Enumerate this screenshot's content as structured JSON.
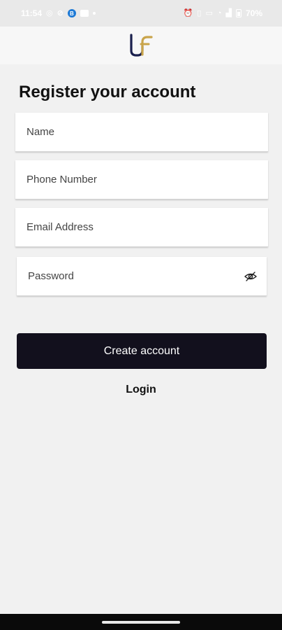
{
  "status_bar": {
    "time": "11:54",
    "battery": "70%",
    "left_icons": [
      "notification-icon",
      "no-sim-icon",
      "app-badge-icon",
      "message-icon",
      "dot-icon"
    ],
    "right_icons": [
      "alarm-icon",
      "vibrate-icon",
      "volte-icon",
      "wifi-icon",
      "signal-icon",
      "battery-icon"
    ]
  },
  "header": {
    "logo": "brand-logo-icon",
    "logo_colors": {
      "primary": "#1a1f4d",
      "accent": "#c9a44a"
    }
  },
  "form": {
    "title": "Register your account",
    "fields": {
      "name_placeholder": "Name",
      "phone_placeholder": "Phone Number",
      "email_placeholder": "Email Address",
      "password_placeholder": "Password"
    },
    "password_toggle_icon": "eye-off-icon"
  },
  "actions": {
    "create_label": "Create account",
    "login_label": "Login"
  },
  "colors": {
    "background": "#f1f1f1",
    "button": "#12101d",
    "button_text": "#ffffff"
  }
}
